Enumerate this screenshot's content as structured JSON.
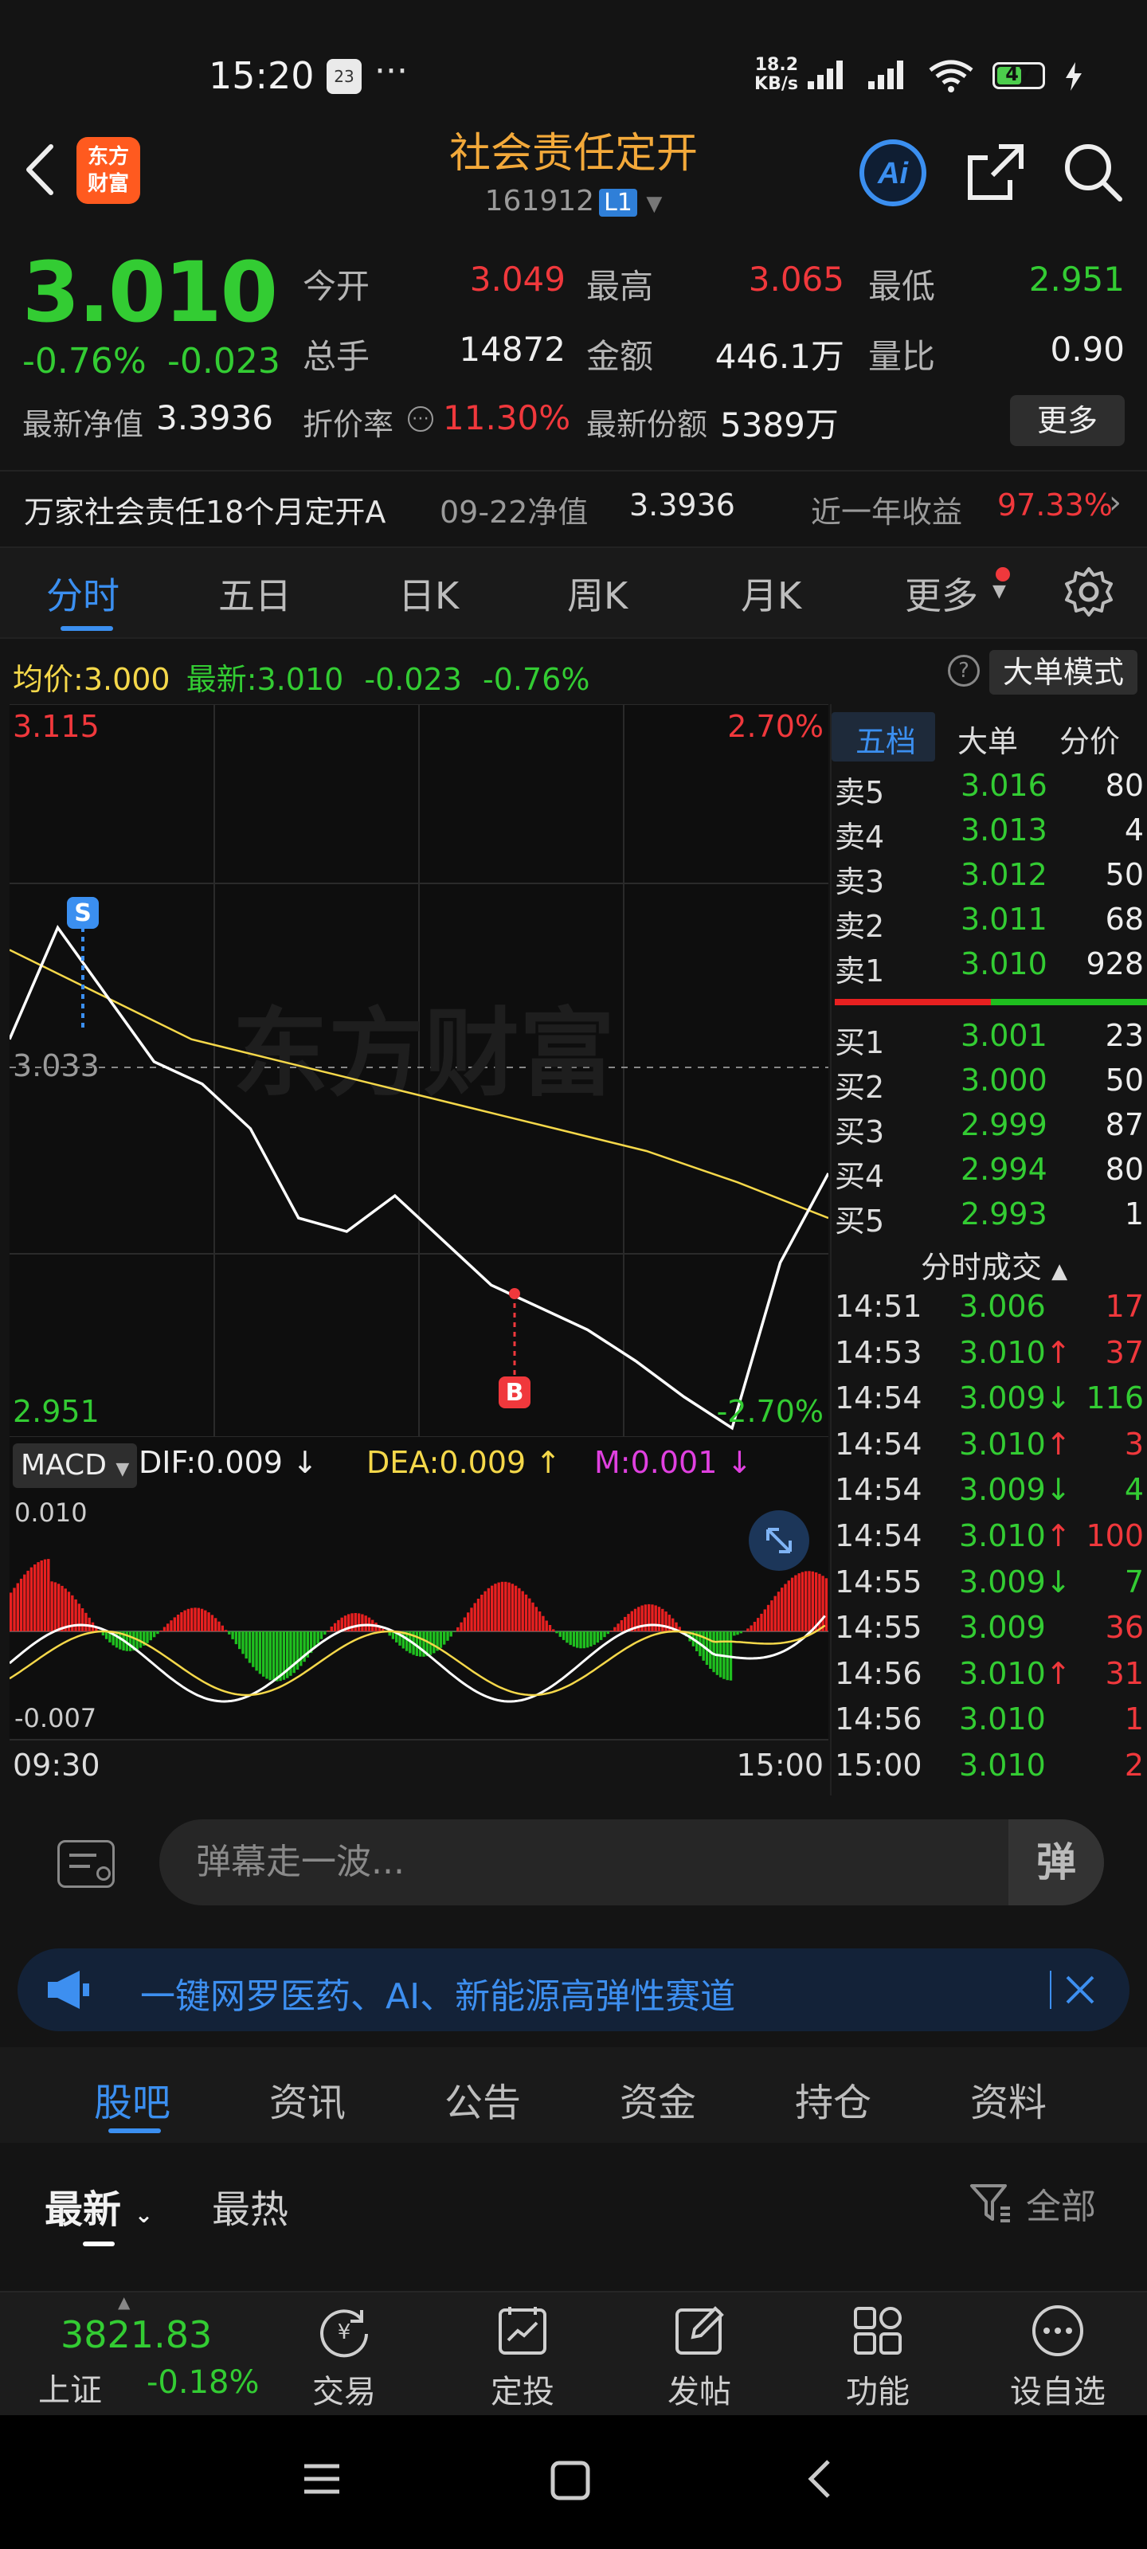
{
  "status": {
    "time": "15:20",
    "calendar_badge": "23",
    "more": "···",
    "net_speed_value": "18.2",
    "net_speed_unit": "KB/s",
    "battery": "47"
  },
  "header": {
    "logo_line1": "东方",
    "logo_line2": "财富",
    "title": "社会责任定开",
    "code": "161912",
    "level": "L1"
  },
  "quote": {
    "price": "3.010",
    "change_pct": "-0.76%",
    "change": "-0.023",
    "open_label": "今开",
    "open": "3.049",
    "high_label": "最高",
    "high": "3.065",
    "low_label": "最低",
    "low": "2.951",
    "volume_label": "总手",
    "volume": "14872",
    "amount_label": "金额",
    "amount": "446.1万",
    "ratio_label": "量比",
    "ratio": "0.90",
    "nav_label": "最新净值",
    "nav": "3.3936",
    "discount_label": "折价率",
    "discount": "11.30%",
    "shares_label": "最新份额",
    "shares": "5389万",
    "more_button": "更多"
  },
  "fund_row": {
    "name": "万家社会责任18个月定开A",
    "nav_date_label": "09-22净值",
    "nav_value": "3.3936",
    "year_return_label": "近一年收益",
    "year_return": "97.33%"
  },
  "period_tabs": [
    "分时",
    "五日",
    "日K",
    "周K",
    "月K",
    "更多"
  ],
  "avg_row": {
    "avg_label": "均价:",
    "avg_value": "3.000",
    "latest_label": "最新:",
    "latest_value": "3.010",
    "change": "-0.023",
    "change_pct": "-0.76%",
    "big_order_button": "大单模式"
  },
  "chart": {
    "y_top": "3.115",
    "y_mid": "3.033",
    "y_bottom": "2.951",
    "pct_top": "2.70%",
    "pct_bottom": "-2.70%",
    "watermark": "东方财富",
    "sell_marker": "S",
    "buy_marker": "B",
    "macd_label": "MACD",
    "dif": "DIF:0.009",
    "dea": "DEA:0.009",
    "m": "M:0.001",
    "macd_top": "0.010",
    "macd_bottom": "-0.007",
    "time_start": "09:30",
    "time_end": "15:00",
    "colors": {
      "price_line": "#ffffff",
      "avg_line": "#f5d84a",
      "up": "#e82020",
      "down": "#1fbf1f"
    }
  },
  "chart_data": {
    "type": "line",
    "x": [
      "09:30",
      "15:00"
    ],
    "ylim": [
      2.951,
      3.115
    ],
    "y_ref": 3.033,
    "series": [
      {
        "values": [
          3.04,
          3.065,
          3.05,
          3.035,
          3.03,
          3.02,
          3.0,
          2.997,
          3.005,
          2.995,
          2.985,
          2.98,
          2.975,
          2.968,
          2.96,
          2.953,
          2.99,
          3.01
        ]
      },
      {
        "values": [
          3.06,
          3.05,
          3.04,
          3.035,
          3.03,
          3.025,
          3.02,
          3.015,
          3.008,
          3.0
        ]
      }
    ]
  },
  "order_book": {
    "tabs": [
      "五档",
      "大单",
      "分价"
    ],
    "asks": [
      {
        "label": "卖5",
        "price": "3.016",
        "vol": "80"
      },
      {
        "label": "卖4",
        "price": "3.013",
        "vol": "4"
      },
      {
        "label": "卖3",
        "price": "3.012",
        "vol": "50"
      },
      {
        "label": "卖2",
        "price": "3.011",
        "vol": "68"
      },
      {
        "label": "卖1",
        "price": "3.010",
        "vol": "928"
      }
    ],
    "bids": [
      {
        "label": "买1",
        "price": "3.001",
        "vol": "23"
      },
      {
        "label": "买2",
        "price": "3.000",
        "vol": "50"
      },
      {
        "label": "买3",
        "price": "2.999",
        "vol": "87"
      },
      {
        "label": "买4",
        "price": "2.994",
        "vol": "80"
      },
      {
        "label": "买5",
        "price": "2.993",
        "vol": "1"
      }
    ],
    "trades_title": "分时成交",
    "trades": [
      {
        "time": "14:51",
        "price": "3.006",
        "vol": "17",
        "dir": ""
      },
      {
        "time": "14:53",
        "price": "3.010",
        "vol": "37",
        "dir": "↑"
      },
      {
        "time": "14:54",
        "price": "3.009",
        "vol": "116",
        "dir": "↓"
      },
      {
        "time": "14:54",
        "price": "3.010",
        "vol": "3",
        "dir": "↑"
      },
      {
        "time": "14:54",
        "price": "3.009",
        "vol": "4",
        "dir": "↓"
      },
      {
        "time": "14:54",
        "price": "3.010",
        "vol": "100",
        "dir": "↑"
      },
      {
        "time": "14:55",
        "price": "3.009",
        "vol": "7",
        "dir": "↓"
      },
      {
        "time": "14:55",
        "price": "3.009",
        "vol": "36",
        "dir": ""
      },
      {
        "time": "14:56",
        "price": "3.010",
        "vol": "31",
        "dir": "↑"
      },
      {
        "time": "14:56",
        "price": "3.010",
        "vol": "1",
        "dir": ""
      },
      {
        "time": "15:00",
        "price": "3.010",
        "vol": "2",
        "dir": ""
      }
    ]
  },
  "danmu": {
    "placeholder": "弹幕走一波...",
    "send": "弹"
  },
  "banner": {
    "text": "一键网罗医药、AI、新能源高弹性赛道"
  },
  "content_tabs": [
    "股吧",
    "资讯",
    "公告",
    "资金",
    "持仓",
    "资料"
  ],
  "sort": {
    "latest": "最新",
    "hot": "最热",
    "filter": "全部"
  },
  "bottom_nav": {
    "index_value": "3821.83",
    "index_name": "上证",
    "index_change": "-0.18%",
    "items": [
      "交易",
      "定投",
      "发帖",
      "功能",
      "设自选"
    ]
  }
}
